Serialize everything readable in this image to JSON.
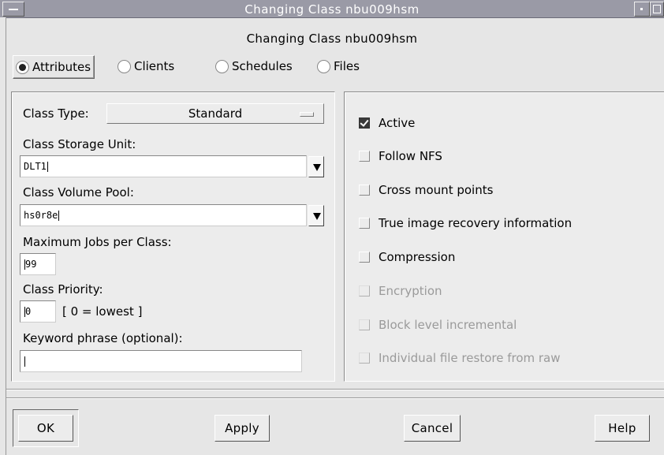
{
  "window": {
    "title": "Changing Class nbu009hsm"
  },
  "dialog": {
    "title": "Changing Class nbu009hsm"
  },
  "tabs": [
    {
      "label": "Attributes",
      "selected": true
    },
    {
      "label": "Clients",
      "selected": false
    },
    {
      "label": "Schedules",
      "selected": false
    },
    {
      "label": "Files",
      "selected": false
    }
  ],
  "left": {
    "class_type_label": "Class Type:",
    "class_type_value": "Standard",
    "storage_unit_label": "Class Storage Unit:",
    "storage_unit_value": "DLT1",
    "volume_pool_label": "Class Volume Pool:",
    "volume_pool_value": "hs0r8e",
    "max_jobs_label": "Maximum Jobs per Class:",
    "max_jobs_value": "99",
    "priority_label": "Class Priority:",
    "priority_value": "0",
    "priority_hint": "[ 0 = lowest ]",
    "keyword_label": "Keyword phrase (optional):",
    "keyword_value": ""
  },
  "options": [
    {
      "label": "Active",
      "checked": true,
      "enabled": true
    },
    {
      "label": "Follow NFS",
      "checked": false,
      "enabled": true
    },
    {
      "label": "Cross mount points",
      "checked": false,
      "enabled": true
    },
    {
      "label": "True image recovery information",
      "checked": false,
      "enabled": true
    },
    {
      "label": "Compression",
      "checked": false,
      "enabled": true
    },
    {
      "label": "Encryption",
      "checked": false,
      "enabled": false
    },
    {
      "label": "Block level incremental",
      "checked": false,
      "enabled": false
    },
    {
      "label": "Individual file restore from raw",
      "checked": false,
      "enabled": false
    }
  ],
  "buttons": {
    "ok": "OK",
    "apply": "Apply",
    "cancel": "Cancel",
    "help": "Help"
  }
}
